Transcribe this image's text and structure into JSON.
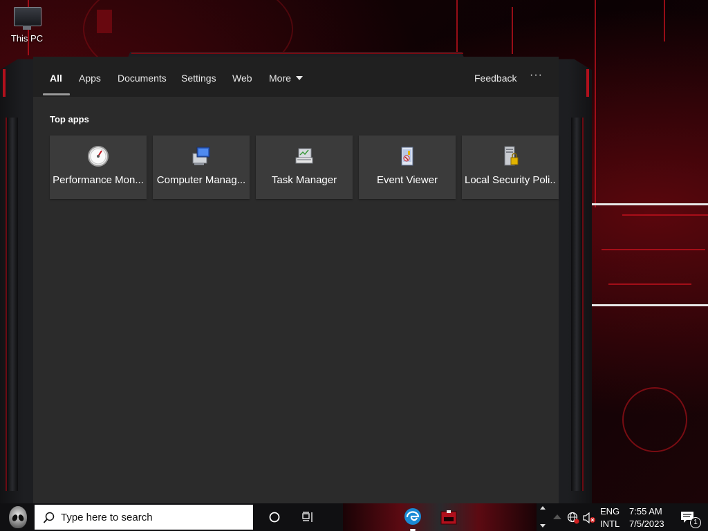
{
  "desktop": {
    "icons": [
      {
        "label": "This PC",
        "icon": "monitor-icon"
      }
    ],
    "wallpaper_accent": "#c4121e"
  },
  "search_flyout": {
    "tabs": [
      {
        "label": "All",
        "active": true
      },
      {
        "label": "Apps",
        "active": false
      },
      {
        "label": "Documents",
        "active": false
      },
      {
        "label": "Settings",
        "active": false
      },
      {
        "label": "Web",
        "active": false
      },
      {
        "label": "More",
        "active": false,
        "has_dropdown": true
      }
    ],
    "feedback_label": "Feedback",
    "more_options_label": "···",
    "section_title": "Top apps",
    "top_apps": [
      {
        "label": "Performance Mon...",
        "icon": "gauge-icon"
      },
      {
        "label": "Computer Manag...",
        "icon": "computer-management-icon"
      },
      {
        "label": "Task Manager",
        "icon": "task-manager-icon"
      },
      {
        "label": "Event Viewer",
        "icon": "event-viewer-icon"
      },
      {
        "label": "Local Security Poli...",
        "icon": "security-policy-icon"
      }
    ],
    "colors": {
      "panel_bg": "#202020",
      "content_bg": "#2b2b2b",
      "tile_bg": "#3b3b3b",
      "text": "#ffffff"
    }
  },
  "taskbar": {
    "search_placeholder": "Type here to search",
    "pinned": [
      {
        "name": "cortana",
        "icon": "cortana-circle-icon"
      },
      {
        "name": "task-view",
        "icon": "task-view-icon"
      },
      {
        "name": "edge",
        "icon": "edge-icon"
      },
      {
        "name": "app",
        "icon": "red-app-icon"
      }
    ],
    "tray": {
      "language_top": "ENG",
      "language_bottom": "INTL",
      "time": "7:55 AM",
      "date": "7/5/2023",
      "notification_count": "1"
    }
  }
}
